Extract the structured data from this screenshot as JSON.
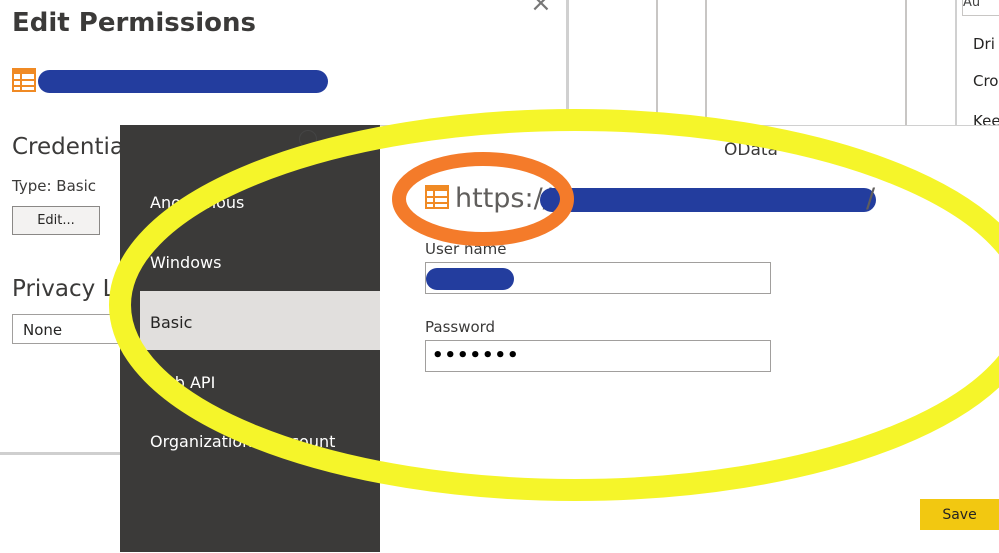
{
  "edit_permissions": {
    "title": "Edit Permissions",
    "close_glyph": "×",
    "credentials_heading": "Credentia",
    "type_label": "Type: Basic",
    "edit_button": "Edit...",
    "privacy_heading": "Privacy Le",
    "privacy_value": "None"
  },
  "right_fragments": {
    "top_box": "Au",
    "item1": "Dri",
    "item2": "Cro",
    "item3": "Kee"
  },
  "auth_nav": {
    "items": [
      {
        "label": "Anonymous"
      },
      {
        "label": "Windows"
      },
      {
        "label": "Basic"
      },
      {
        "label": "Web API"
      },
      {
        "label": "Organizational account"
      }
    ],
    "selected": "Basic"
  },
  "auth_panel": {
    "source_type": "OData",
    "url_prefix": "https://",
    "url_suffix": "/",
    "username_label": "User name",
    "password_label": "Password",
    "password_value": "•••••••",
    "save_button": "Save"
  },
  "colors": {
    "nav_bg": "#3b3a39",
    "nav_selected": "#e1dfdd",
    "save_accent": "#f2c811",
    "redaction": "#233d9e",
    "highlight_yellow": "#f5f52a",
    "highlight_orange": "#f47b2a",
    "table_icon": "#f08a24"
  },
  "icons": [
    "table-icon",
    "close-icon"
  ]
}
